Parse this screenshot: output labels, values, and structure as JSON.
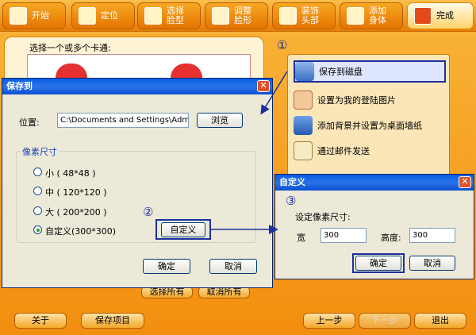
{
  "toolbar": {
    "items": [
      {
        "label": "开始"
      },
      {
        "label": "定位"
      },
      {
        "label": "选择\n脸型"
      },
      {
        "label": "调整\n脸形"
      },
      {
        "label": "装饰\n头部"
      },
      {
        "label": "添加\n身体"
      },
      {
        "label": "完成"
      }
    ]
  },
  "main": {
    "prompt": "选择一个或多个卡通:",
    "select_all": "选择所有",
    "deselect_all": "取消所有"
  },
  "side_menu": {
    "items": [
      {
        "label": "保存到磁盘"
      },
      {
        "label": "设置为我的登陆图片"
      },
      {
        "label": "添加背景并设置为桌面墙纸"
      },
      {
        "label": "通过邮件发送"
      }
    ]
  },
  "markers": {
    "one": "①",
    "two": "②",
    "three": "③"
  },
  "save_dialog": {
    "title": "保存到",
    "location_label": "位置:",
    "location_value": "C:\\Documents and Settings\\Administratc",
    "browse": "浏览",
    "group_label": "像素尺寸",
    "options": [
      {
        "label": "小 ( 48*48 )"
      },
      {
        "label": "中 ( 120*120 )"
      },
      {
        "label": "大 ( 200*200 )"
      },
      {
        "label": "自定义(300*300)"
      }
    ],
    "custom_button": "自定义",
    "ok": "确定",
    "cancel": "取消"
  },
  "custom_dialog": {
    "title": "自定义",
    "heading": "设定像素尺寸:",
    "width_label": "宽",
    "width_value": "300",
    "height_label": "高度:",
    "height_value": "300",
    "ok": "确定",
    "cancel": "取消"
  },
  "bottom": {
    "about": "关于",
    "save_project": "保存项目",
    "prev": "上一步",
    "next": "下一步",
    "exit": "退出"
  }
}
